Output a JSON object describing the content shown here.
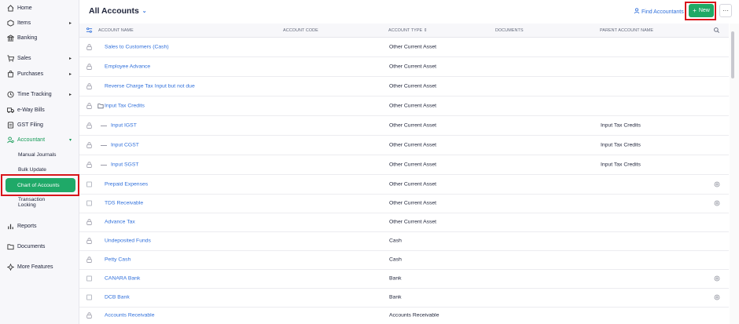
{
  "sidebar": {
    "items": [
      {
        "label": "Home",
        "icon": "home-icon"
      },
      {
        "label": "Items",
        "icon": "items-icon",
        "chevron": "▸"
      },
      {
        "label": "Banking",
        "icon": "bank-icon"
      },
      {
        "label": "Sales",
        "icon": "cart-icon",
        "chevron": "▸"
      },
      {
        "label": "Purchases",
        "icon": "bag-icon",
        "chevron": "▸"
      },
      {
        "label": "Time Tracking",
        "icon": "clock-icon",
        "chevron": "▸"
      },
      {
        "label": "e-Way Bills",
        "icon": "truck-icon"
      },
      {
        "label": "GST Filing",
        "icon": "document-icon"
      },
      {
        "label": "Accountant",
        "icon": "accountant-icon",
        "chevron": "▾"
      }
    ],
    "subitems": [
      {
        "label": "Manual Journals"
      },
      {
        "label": "Bulk Update"
      },
      {
        "label": "Chart of Accounts"
      },
      {
        "label": "Transaction"
      },
      {
        "label": "Locking"
      }
    ],
    "bottom": [
      {
        "label": "Reports",
        "icon": "reports-icon"
      },
      {
        "label": "Documents",
        "icon": "folder-icon"
      },
      {
        "label": "More Features",
        "icon": "sparkle-icon"
      }
    ]
  },
  "header": {
    "title": "All Accounts",
    "title_chevron": "⌄",
    "find_accountants": "Find Accountants",
    "new_label": "New",
    "new_plus": "+",
    "more_glyph": "···"
  },
  "table": {
    "columns": {
      "name": "ACCOUNT NAME",
      "code": "ACCOUNT CODE",
      "type": "ACCOUNT TYPE",
      "type_sort": "⇕",
      "documents": "DOCUMENTS",
      "parent": "PARENT ACCOUNT NAME"
    },
    "rows": [
      {
        "name": "Sales to Customers (Cash)",
        "type": "Other Current Asset",
        "parent": "",
        "icon": "lock"
      },
      {
        "name": "Employee Advance",
        "type": "Other Current Asset",
        "parent": "",
        "icon": "lock"
      },
      {
        "name": "Reverse Charge Tax Input but not due",
        "type": "Other Current Asset",
        "parent": "",
        "icon": "lock"
      },
      {
        "name": "Input Tax Credits",
        "type": "Other Current Asset",
        "parent": "",
        "icon": "lock"
      },
      {
        "name": "Input IGST",
        "type": "Other Current Asset",
        "parent": "Input Tax Credits",
        "icon": "lock"
      },
      {
        "name": "Input CGST",
        "type": "Other Current Asset",
        "parent": "Input Tax Credits",
        "icon": "lock"
      },
      {
        "name": "Input SGST",
        "type": "Other Current Asset",
        "parent": "Input Tax Credits",
        "icon": "lock"
      },
      {
        "name": "Prepaid Expenses",
        "type": "Other Current Asset",
        "parent": "",
        "icon": "checkbox"
      },
      {
        "name": "TDS Receivable",
        "type": "Other Current Asset",
        "parent": "",
        "icon": "checkbox"
      },
      {
        "name": "Advance Tax",
        "type": "Other Current Asset",
        "parent": "",
        "icon": "lock"
      },
      {
        "name": "Undeposited Funds",
        "type": "Cash",
        "parent": "",
        "icon": "lock"
      },
      {
        "name": "Petty Cash",
        "type": "Cash",
        "parent": "",
        "icon": "lock"
      },
      {
        "name": "CANARA Bank",
        "type": "Bank",
        "parent": "",
        "icon": "checkbox"
      },
      {
        "name": "DCB Bank",
        "type": "Bank",
        "parent": "",
        "icon": "checkbox"
      },
      {
        "name": "Accounts Receivable",
        "type": "Accounts Receivable",
        "parent": "",
        "icon": "lock"
      }
    ]
  },
  "colors": {
    "accent_green": "#1fa968",
    "link_blue": "#2f6fdb",
    "highlight_red": "#d8151b"
  }
}
